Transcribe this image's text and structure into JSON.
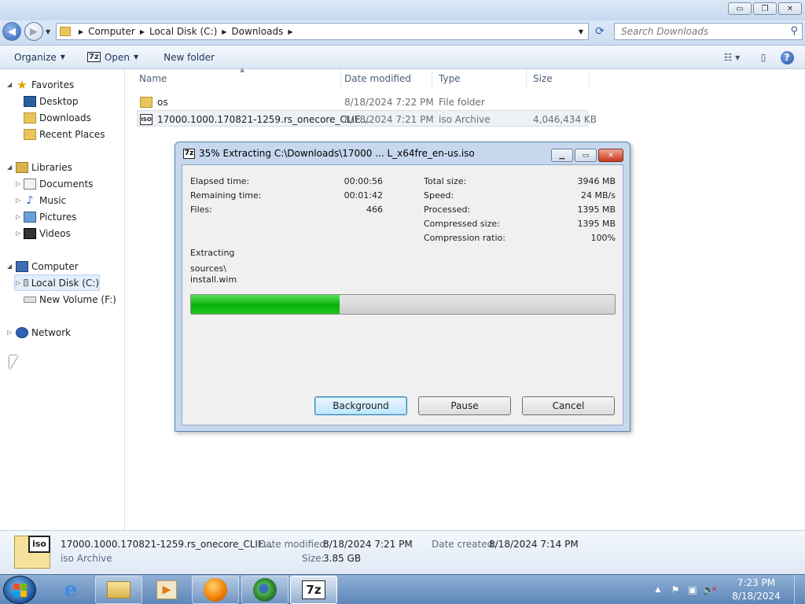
{
  "window": {
    "caption_buttons": [
      "▭",
      "❐",
      "✕"
    ]
  },
  "address_bar": {
    "breadcrumbs": [
      "Computer",
      "Local Disk (C:)",
      "Downloads"
    ],
    "search_placeholder": "Search Downloads"
  },
  "toolbar": {
    "organize_label": "Organize",
    "open_label": "Open",
    "open_icon_text": "7z",
    "new_folder_label": "New folder",
    "help_icon_text": "?"
  },
  "nav_pane": {
    "favorites_label": "Favorites",
    "favorites": [
      "Desktop",
      "Downloads",
      "Recent Places"
    ],
    "libraries_label": "Libraries",
    "libraries": [
      "Documents",
      "Music",
      "Pictures",
      "Videos"
    ],
    "computer_label": "Computer",
    "drives": [
      "Local Disk (C:)",
      "New Volume (F:)"
    ],
    "network_label": "Network"
  },
  "file_list": {
    "columns": [
      "Name",
      "Date modified",
      "Type",
      "Size"
    ],
    "rows": [
      {
        "name": "os",
        "modified": "8/18/2024 7:22 PM",
        "type": "File folder",
        "size": "",
        "icon": "folder-icon"
      },
      {
        "name": "17000.1000.170821-1259.rs_onecore_CLIE...",
        "modified": "8/18/2024 7:21 PM",
        "type": "iso Archive",
        "size": "4,046,434 KB",
        "icon": "iso-icon"
      }
    ]
  },
  "dialog": {
    "icon_text": "7z",
    "title": "35% Extracting C:\\Downloads\\17000 ... L_x64fre_en-us.iso",
    "left_stats": [
      {
        "label": "Elapsed time:",
        "value": "00:00:56"
      },
      {
        "label": "Remaining time:",
        "value": "00:01:42"
      },
      {
        "label": "Files:",
        "value": "466"
      }
    ],
    "right_stats": [
      {
        "label": "Total size:",
        "value": "3946 MB"
      },
      {
        "label": "Speed:",
        "value": "24 MB/s"
      },
      {
        "label": "Processed:",
        "value": "1395 MB"
      },
      {
        "label": "Compressed size:",
        "value": "1395 MB"
      },
      {
        "label": "Compression ratio:",
        "value": "100%"
      }
    ],
    "action_label": "Extracting",
    "current_path": "sources\\",
    "current_file": "install.wim",
    "progress_percent": 35,
    "buttons": {
      "background": "Background",
      "pause": "Pause",
      "cancel": "Cancel"
    }
  },
  "details_pane": {
    "icon_text": "iso",
    "filename": "17000.1000.170821-1259.rs_onecore_CLIE...",
    "type": "iso Archive",
    "modified_label": "Date modified:",
    "modified_value": "8/18/2024 7:21 PM",
    "created_label": "Date created:",
    "created_value": "8/18/2024 7:14 PM",
    "size_label": "Size:",
    "size_value": "3.85 GB"
  },
  "taskbar": {
    "app_7z_text": "7z",
    "clock_time": "7:23 PM",
    "clock_date": "8/18/2024"
  },
  "colors": {
    "progress_fill": "#06b006",
    "accent": "#2f61b5"
  }
}
